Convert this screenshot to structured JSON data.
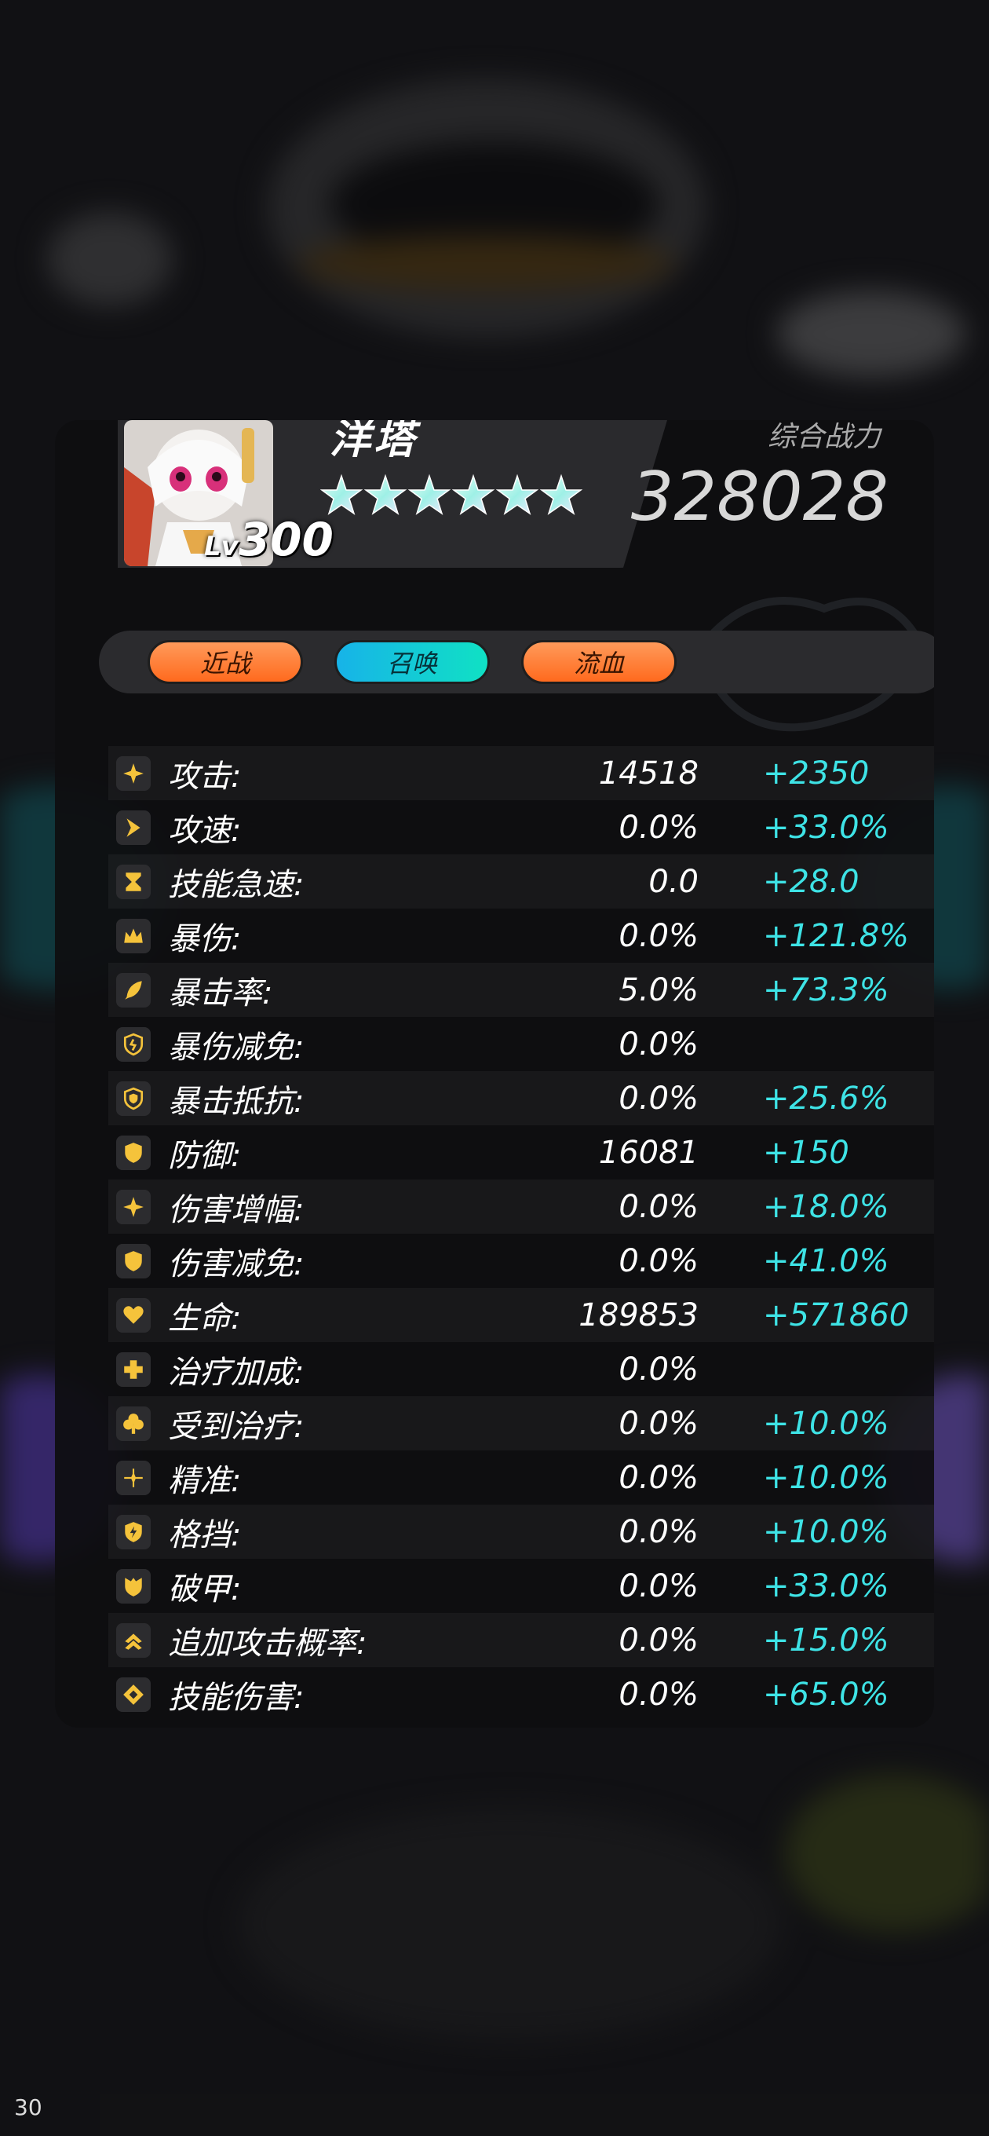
{
  "hero": {
    "name": "洋塔",
    "level_label": "Lv",
    "level": "300",
    "stars": 6,
    "combat_power_label": "综合战力",
    "combat_power": "328028"
  },
  "tags": [
    {
      "label": "近战",
      "color": "#ff7a32"
    },
    {
      "label": "召唤",
      "color": "#15c6d8"
    },
    {
      "label": "流血",
      "color": "#ff7a32"
    }
  ],
  "stats": [
    {
      "icon": "sparkle-icon",
      "label": "攻击:",
      "base": "14518",
      "bonus": "+2350"
    },
    {
      "icon": "chevron-right-icon",
      "label": "攻速:",
      "base": "0.0%",
      "bonus": "+33.0%"
    },
    {
      "icon": "hourglass-icon",
      "label": "技能急速:",
      "base": "0.0",
      "bonus": "+28.0"
    },
    {
      "icon": "crown-icon",
      "label": "暴伤:",
      "base": "0.0%",
      "bonus": "+121.8%"
    },
    {
      "icon": "feather-icon",
      "label": "暴击率:",
      "base": "5.0%",
      "bonus": "+73.3%"
    },
    {
      "icon": "shield-crack-icon",
      "label": "暴伤减免:",
      "base": "0.0%",
      "bonus": ""
    },
    {
      "icon": "shield-inner-icon",
      "label": "暴击抵抗:",
      "base": "0.0%",
      "bonus": "+25.6%"
    },
    {
      "icon": "shield-icon",
      "label": "防御:",
      "base": "16081",
      "bonus": "+150"
    },
    {
      "icon": "sparkle-icon",
      "label": "伤害增幅:",
      "base": "0.0%",
      "bonus": "+18.0%"
    },
    {
      "icon": "shield-icon",
      "label": "伤害减免:",
      "base": "0.0%",
      "bonus": "+41.0%"
    },
    {
      "icon": "heart-icon",
      "label": "生命:",
      "base": "189853",
      "bonus": "+571860"
    },
    {
      "icon": "cross-icon",
      "label": "治疗加成:",
      "base": "0.0%",
      "bonus": ""
    },
    {
      "icon": "clover-icon",
      "label": "受到治疗:",
      "base": "0.0%",
      "bonus": "+10.0%"
    },
    {
      "icon": "crosshair-icon",
      "label": "精准:",
      "base": "0.0%",
      "bonus": "+10.0%"
    },
    {
      "icon": "shield-bolt-icon",
      "label": "格挡:",
      "base": "0.0%",
      "bonus": "+10.0%"
    },
    {
      "icon": "broken-shield-icon",
      "label": "破甲:",
      "base": "0.0%",
      "bonus": "+33.0%"
    },
    {
      "icon": "double-up-icon",
      "label": "追加攻击概率:",
      "base": "0.0%",
      "bonus": "+15.0%"
    },
    {
      "icon": "diamond-icon",
      "label": "技能伤害:",
      "base": "0.0%",
      "bonus": "+65.0%"
    }
  ],
  "fps": "30",
  "colors": {
    "accent": "#3ee3e6",
    "icon": "#f5c33b",
    "panel": "#0e0e10"
  }
}
